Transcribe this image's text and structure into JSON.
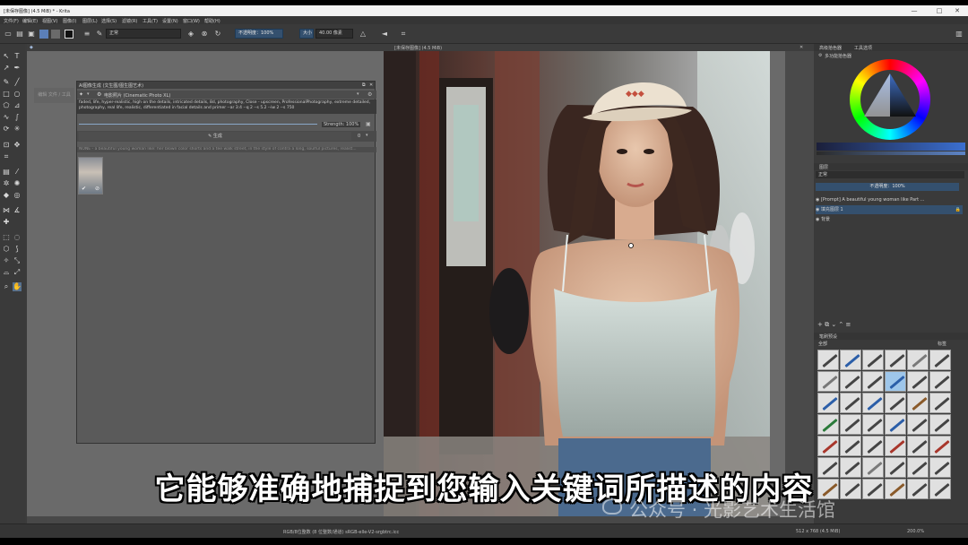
{
  "window": {
    "title": "[未保存图像] (4.5 MiB) * - Krita",
    "controls": [
      "—",
      "□",
      "✕"
    ]
  },
  "menu": [
    "文件(F)",
    "编辑(E)",
    "视图(V)",
    "图像(I)",
    "图层(L)",
    "选择(S)",
    "滤镜(R)",
    "工具(T)",
    "设置(N)",
    "窗口(W)",
    "帮助(H)"
  ],
  "toolbar": {
    "blend_mode": "正常",
    "opacity": "不透明度：100%",
    "size": "40.00 像素",
    "size_label": "大小"
  },
  "document": {
    "tab_title": "[未保存图像] (4.5 MiB)"
  },
  "ai_panel": {
    "title": "AI图像生成 (文生图/图生图艺术)",
    "style": "电影照片 (Cinematic Photo XL)",
    "prompt": "faded, life, hyper-realistic, high on the details, intricated details, 8d, photography, Close - upscreen, ProfessionalPhotography, extreme detailed, photography, real life, realistic, differentiated in facial details and primer --ar 3:4 --q 2 --s 5.2 --iw 2 --s 750",
    "strength": "Strength: 100%",
    "generate": "生成",
    "count": "0",
    "negative": "NONE - a beautiful young woman like: her blown color shorts and a tee walk street, in the style of contra a long, soulful pictures, realist..."
  },
  "side_button": "编辑 文件 / 工具",
  "status": {
    "color_model": "RGB/8位整数 (8 位整数/通道) sRGB-elle-V2-srgbtrc.icc",
    "dimensions": "512 x 768 (4.5 MiB)",
    "zoom": "200.0%"
  },
  "dock": {
    "color_tabs": [
      "高级拾色器",
      "工具选项"
    ],
    "color_title": "多功能拾色器",
    "layers_title": "图层",
    "layer_blend": "正常",
    "layer_opacity": "不透明度：100%",
    "layers": [
      {
        "name": "[Prompt] A beautiful young woman like Part ..."
      },
      {
        "name": "填充图层 1"
      },
      {
        "name": "背景"
      }
    ],
    "brushes_title": "笔刷预设",
    "brush_filter": "全部",
    "brush_tag": "标签"
  },
  "overlay": {
    "subtitle": "它能够准确地捕捉到您输入关键词所描述的内容",
    "watermark": "公众号 · 光影艺术生活馆"
  },
  "colors": {
    "accent": "#34506e",
    "panel_bg": "#3a3a3a",
    "canvas_bg": "#6a6a6a"
  }
}
